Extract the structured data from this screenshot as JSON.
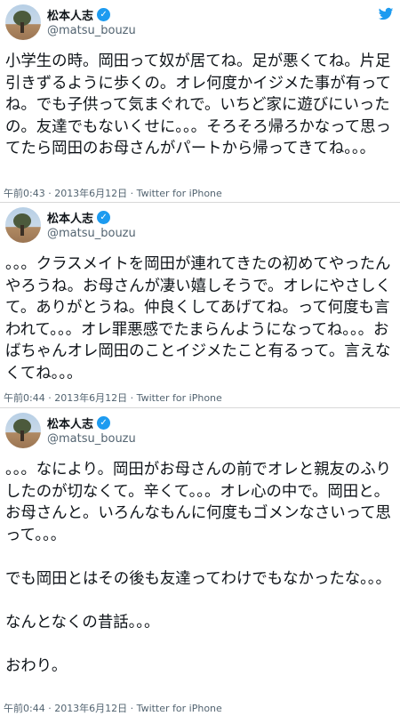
{
  "tweets": [
    {
      "name": "松本人志",
      "handle": "@matsu_bouzu",
      "text": "小学生の時。岡田って奴が居てね。足が悪くてね。片足引きずるように歩くの。オレ何度かイジメた事が有ってね。でも子供って気まぐれで。いちど家に遊びにいったの。友達でもないくせに。。。そろそろ帰ろかなって思ってたら岡田のお母さんがパートから帰ってきてね。。。",
      "meta": "午前0:43 · 2013年6月12日 · Twitter for iPhone"
    },
    {
      "name": "松本人志",
      "handle": "@matsu_bouzu",
      "text": "。。。クラスメイトを岡田が連れてきたの初めてやったんやろうね。お母さんが凄い嬉しそうで。オレにやさしくて。ありがとうね。仲良くしてあげてね。って何度も言われて。。。オレ罪悪感でたまらんようになってね。。。おばちゃんオレ岡田のことイジメたこと有るって。言えなくてね。。。",
      "meta": "午前0:44 · 2013年6月12日 · Twitter for iPhone"
    },
    {
      "name": "松本人志",
      "handle": "@matsu_bouzu",
      "text": "。。。なにより。岡田がお母さんの前でオレと親友のふりしたのが切なくて。辛くて。。。オレ心の中で。岡田と。お母さんと。いろんなもんに何度もゴメンなさいって思って。。。\n\nでも岡田とはその後も友達ってわけでもなかったな。。。\n\nなんとなくの昔話。。。\n\nおわり。",
      "meta": "午前0:44 · 2013年6月12日 · Twitter for iPhone"
    }
  ],
  "icons": {
    "verified": "verified-badge-icon",
    "platform": "twitter-bird-icon"
  },
  "colors": {
    "verified": "#1d9bf0",
    "text": "#0f1419",
    "muted": "#536471"
  }
}
